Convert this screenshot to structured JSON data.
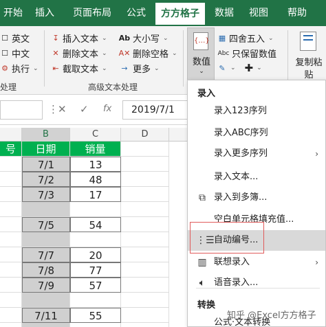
{
  "tabs": [
    "开始",
    "插入",
    "页面布局",
    "公式",
    "方方格子",
    "数据",
    "视图",
    "帮助"
  ],
  "ribbon": {
    "left_items": [
      "英文",
      "中文",
      "执行"
    ],
    "left_group_label": "处理",
    "text_items": [
      "插入文本",
      "删除文本",
      "截取文本"
    ],
    "case_items": [
      "大小写",
      "删除空格",
      "更多"
    ],
    "group_label": "高级文本处理",
    "number_button": "数值",
    "right_items": [
      "四舍五入",
      "只保留数值"
    ],
    "copy_paste_label": [
      "复制粘",
      "贴"
    ]
  },
  "formula_bar": {
    "value": "2019/7/1",
    "fx": "fx"
  },
  "columns": [
    "B",
    "C",
    "D"
  ],
  "table": {
    "header_a": "号",
    "header_b": "日期",
    "header_c": "销量",
    "rows": [
      {
        "b": "7/1",
        "c": "13"
      },
      {
        "b": "7/2",
        "c": "48"
      },
      {
        "b": "7/3",
        "c": "17"
      },
      {
        "b": "",
        "c": ""
      },
      {
        "b": "7/5",
        "c": "54"
      },
      {
        "b": "",
        "c": ""
      },
      {
        "b": "7/7",
        "c": "20"
      },
      {
        "b": "7/8",
        "c": "77"
      },
      {
        "b": "7/9",
        "c": "57"
      },
      {
        "b": "",
        "c": ""
      },
      {
        "b": "7/11",
        "c": "55"
      },
      {
        "b": "",
        "c": ""
      }
    ]
  },
  "menu": {
    "section1": "录入",
    "items": [
      {
        "label": "录入123序列",
        "icon": "none",
        "arrow": false
      },
      {
        "label": "录入ABC序列",
        "icon": "none",
        "arrow": false
      },
      {
        "label": "录入更多序列",
        "icon": "none",
        "arrow": true
      },
      {
        "label": "录入文本...",
        "icon": "none",
        "arrow": false
      },
      {
        "label": "录入到多簿...",
        "icon": "multi-book-icon",
        "arrow": false
      },
      {
        "label": "空白单元格填充值...",
        "icon": "none",
        "arrow": false
      },
      {
        "label": "自动编号...",
        "icon": "numbered-list-icon",
        "arrow": false
      },
      {
        "label": "联想录入",
        "icon": "association-icon",
        "arrow": true
      },
      {
        "label": "语音录入...",
        "icon": "speaker-icon",
        "arrow": false
      }
    ],
    "section2": "转换",
    "last_item": "公式·文本转换"
  },
  "watermark": "知乎 @Excel方方格子",
  "colors": {
    "excel_green": "#217346",
    "header_green": "#00b050"
  }
}
